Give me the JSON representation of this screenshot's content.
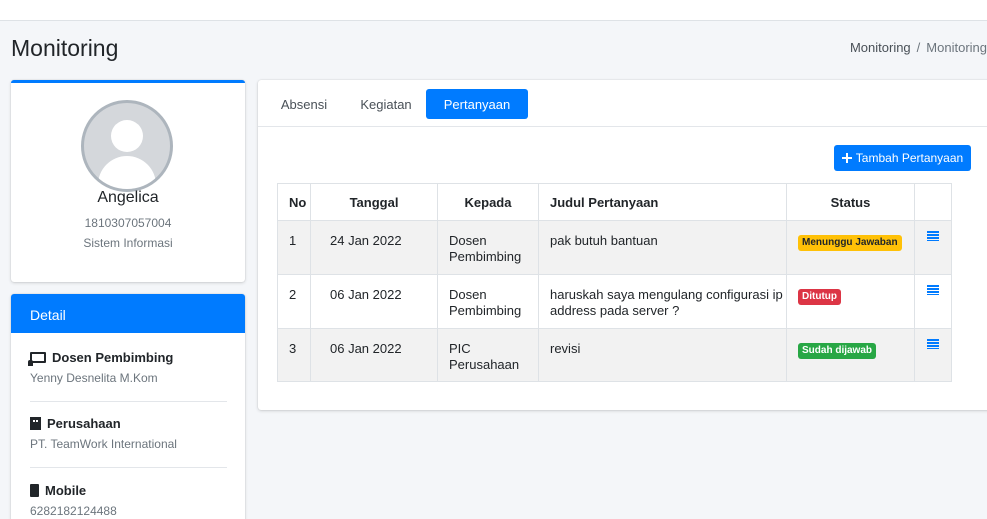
{
  "header": {
    "page_title": "Monitoring",
    "breadcrumb": {
      "link": "Monitoring",
      "separator": "/",
      "active": "Monitoring"
    }
  },
  "profile": {
    "name": "Angelica",
    "nim": "1810307057004",
    "prodi": "Sistem Informasi"
  },
  "detail": {
    "title": "Detail",
    "items": [
      {
        "icon": "chalkboard-teacher-icon",
        "label": "Dosen Pembimbing",
        "value": "Yenny Desnelita M.Kom"
      },
      {
        "icon": "building-icon",
        "label": "Perusahaan",
        "value": "PT. TeamWork International"
      },
      {
        "icon": "mobile-icon",
        "label": "Mobile",
        "value": "6282182124488"
      }
    ]
  },
  "tabs": [
    {
      "label": "Absensi",
      "active": false
    },
    {
      "label": "Kegiatan",
      "active": false
    },
    {
      "label": "Pertanyaan",
      "active": true
    }
  ],
  "add_button": {
    "label": "Tambah Pertanyaan",
    "icon": "plus-icon"
  },
  "table": {
    "columns": [
      "No",
      "Tanggal",
      "Kepada",
      "Judul Pertanyaan",
      "Status",
      ""
    ],
    "rows": [
      {
        "no": "1",
        "tanggal": "24 Jan 2022",
        "kepada": "Dosen Pembimbing",
        "judul": "pak butuh bantuan",
        "status": "Menunggu Jawaban",
        "status_color": "#ffc107"
      },
      {
        "no": "2",
        "tanggal": "06 Jan 2022",
        "kepada": "Dosen Pembimbing",
        "judul": "haruskah saya mengulang configurasi ip address pada server ?",
        "status": "Ditutup",
        "status_color": "#dc3545"
      },
      {
        "no": "3",
        "tanggal": "06 Jan 2022",
        "kepada": "PIC Perusahaan",
        "judul": "revisi",
        "status": "Sudah dijawab",
        "status_color": "#28a745"
      }
    ]
  },
  "colors": {
    "primary": "#007bff",
    "background": "#f4f6f9"
  }
}
